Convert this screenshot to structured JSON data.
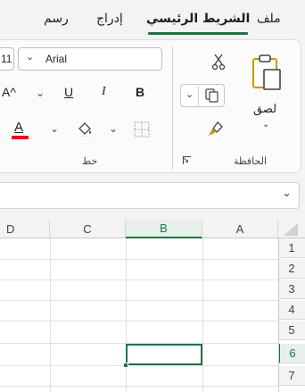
{
  "tabs": {
    "file": "ملف",
    "home": "الشريط الرئيسي",
    "insert": "إدراج",
    "draw": "رسم"
  },
  "clipboard": {
    "paste_label": "لصق",
    "group_label": "الحافظة"
  },
  "font": {
    "name": "Arial",
    "size": "11",
    "group_label": "خط",
    "bold": "B",
    "italic": "I",
    "underline": "U",
    "font_color": "A",
    "increase_size": "A^"
  },
  "columns": [
    "A",
    "B",
    "C",
    "D"
  ],
  "selected_column": "B",
  "rows": [
    "1",
    "2",
    "3",
    "4",
    "5",
    "6",
    "7"
  ],
  "selected_row": "6",
  "colors": {
    "accent": "#217346",
    "font_color_bar": "#e81123"
  }
}
